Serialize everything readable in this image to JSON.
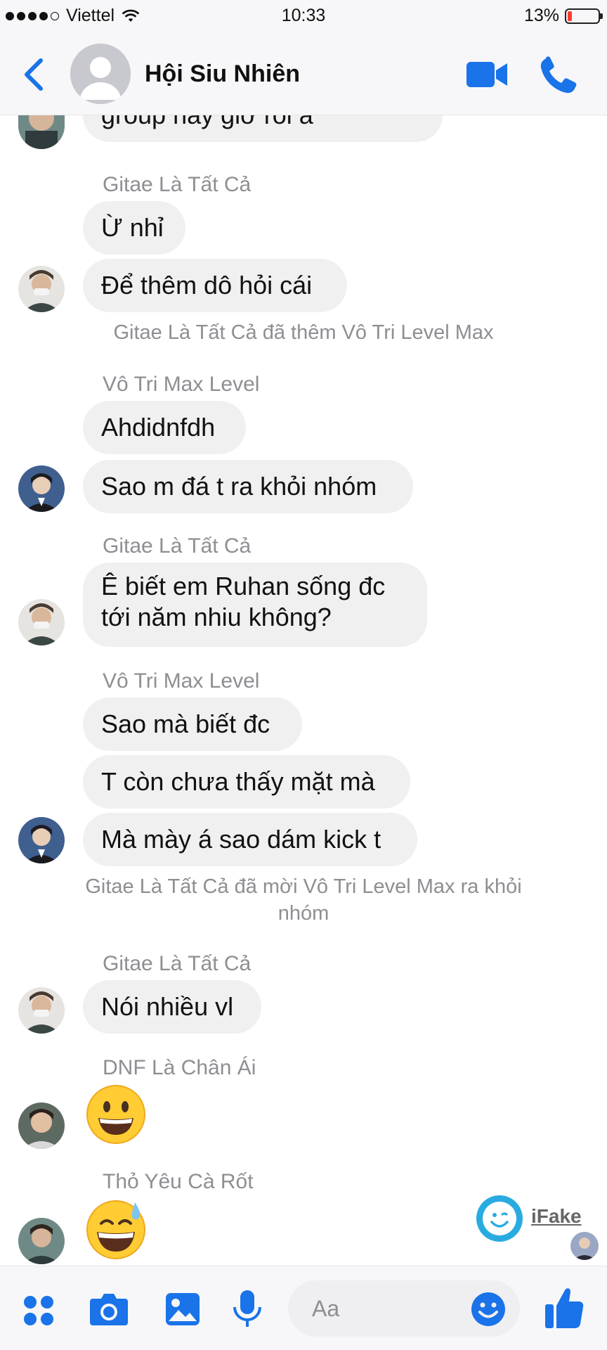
{
  "status_bar": {
    "carrier": "Viettel",
    "time": "10:33",
    "battery_text": "13%",
    "battery_level": 0.13
  },
  "header": {
    "title": "Hội Siu Nhiên",
    "back_icon": "chevron-left-icon",
    "video_icon": "video-camera-icon",
    "phone_icon": "phone-icon"
  },
  "messages": {
    "m1": "group này giờ rồi á",
    "s1": "Gitae Là Tất Cả",
    "m2": "Ừ nhỉ",
    "m3": "Để thêm dô hỏi cái",
    "n1": "Gitae Là Tất Cả đã thêm Vô Tri Level Max",
    "s2": "Vô Tri Max Level",
    "m4": "Ahdidnfdh",
    "m5": "Sao m đá t ra khỏi nhóm",
    "s3": "Gitae Là Tất Cả",
    "m6_line1": "Ê biết em Ruhan sống đc",
    "m6_line2": "tới năm nhiu không?",
    "s4": "Vô Tri Max Level",
    "m7": "Sao mà biết đc",
    "m8": "T còn chưa thấy mặt mà",
    "m9": "Mà mày á sao dám kick t",
    "n2_line1": "Gitae Là Tất Cả đã mời Vô Tri Level Max ra khỏi",
    "n2_line2": "nhóm",
    "s5": "Gitae Là Tất Cả",
    "m10": "Nói nhiều vl",
    "s6": "DNF Là Chân Ái",
    "s7": "Thỏ Yêu Cà Rốt"
  },
  "composer": {
    "placeholder": "Aa"
  },
  "watermark": {
    "text": "iFake"
  },
  "colors": {
    "accent": "#1a73e8",
    "bubble": "#f0f0f1",
    "meta_text": "#8e8e93"
  }
}
